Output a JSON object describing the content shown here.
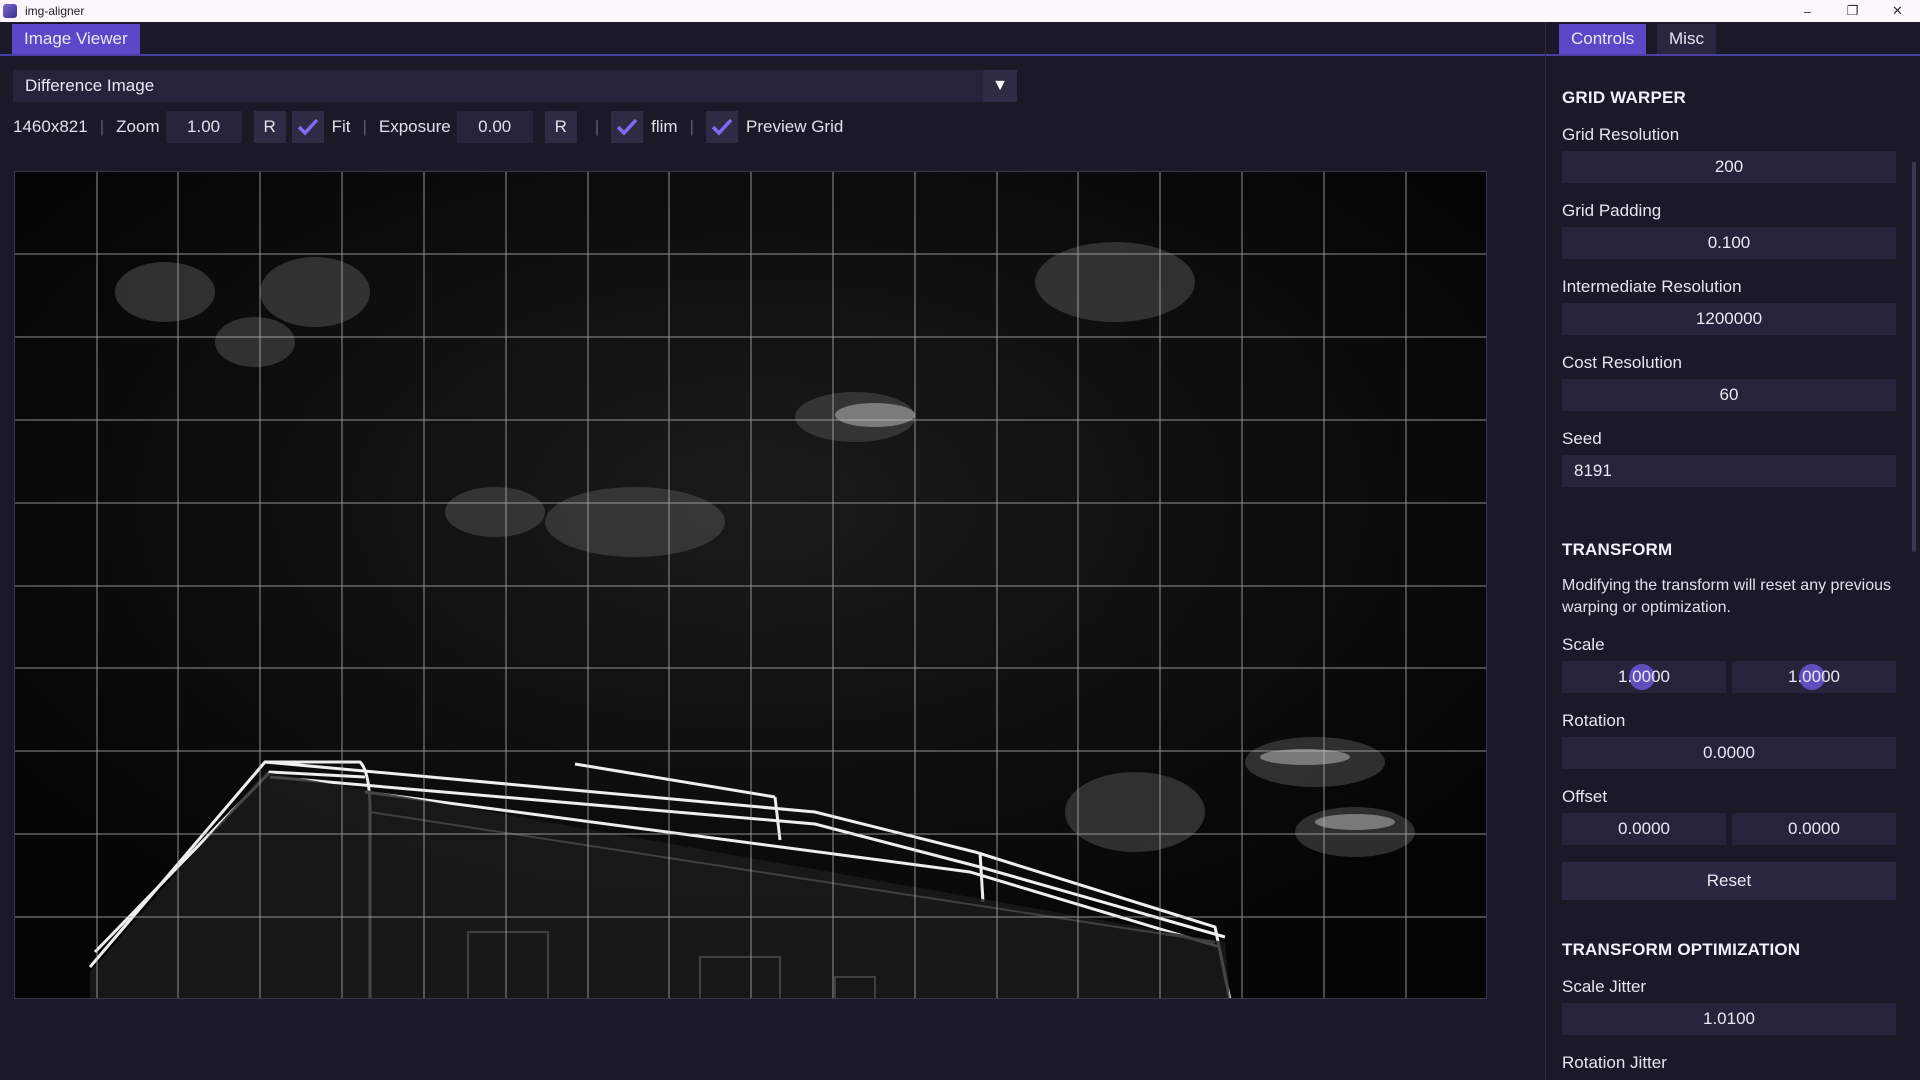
{
  "window": {
    "title": "img-aligner",
    "controls": [
      "–",
      "❐",
      "✕"
    ]
  },
  "left_tabs": [
    "Image Viewer"
  ],
  "view_select": {
    "value": "Difference Image"
  },
  "toolbar": {
    "dimensions": "1460x821",
    "zoom_label": "Zoom",
    "zoom_value": "1.00",
    "reset_zoom": "R",
    "fit_label": "Fit",
    "exposure_label": "Exposure",
    "exposure_value": "0.00",
    "reset_exposure": "R",
    "flim_label": "flim",
    "preview_grid_label": "Preview Grid",
    "separator": "|"
  },
  "right_tabs": [
    "Controls",
    "Misc"
  ],
  "grid_warper": {
    "heading": "GRID WARPER",
    "grid_resolution_label": "Grid Resolution",
    "grid_resolution": "200",
    "grid_padding_label": "Grid Padding",
    "grid_padding": "0.100",
    "intermediate_resolution_label": "Intermediate Resolution",
    "intermediate_resolution": "1200000",
    "cost_resolution_label": "Cost Resolution",
    "cost_resolution": "60",
    "seed_label": "Seed",
    "seed": "8191"
  },
  "transform": {
    "heading": "TRANSFORM",
    "note": "Modifying the transform will reset any previous warping or optimization.",
    "scale_label": "Scale",
    "scale_x": "1.0000",
    "scale_y": "1.0000",
    "rotation_label": "Rotation",
    "rotation": "0.0000",
    "offset_label": "Offset",
    "offset_x": "0.0000",
    "offset_y": "0.0000",
    "reset_label": "Reset"
  },
  "transform_optimization": {
    "heading": "TRANSFORM OPTIMIZATION",
    "scale_jitter_label": "Scale Jitter",
    "scale_jitter": "1.0100",
    "rotation_jitter_label": "Rotation Jitter"
  },
  "colors": {
    "accent": "#5a48c8",
    "panel": "#1b1927",
    "field": "#26233a"
  }
}
